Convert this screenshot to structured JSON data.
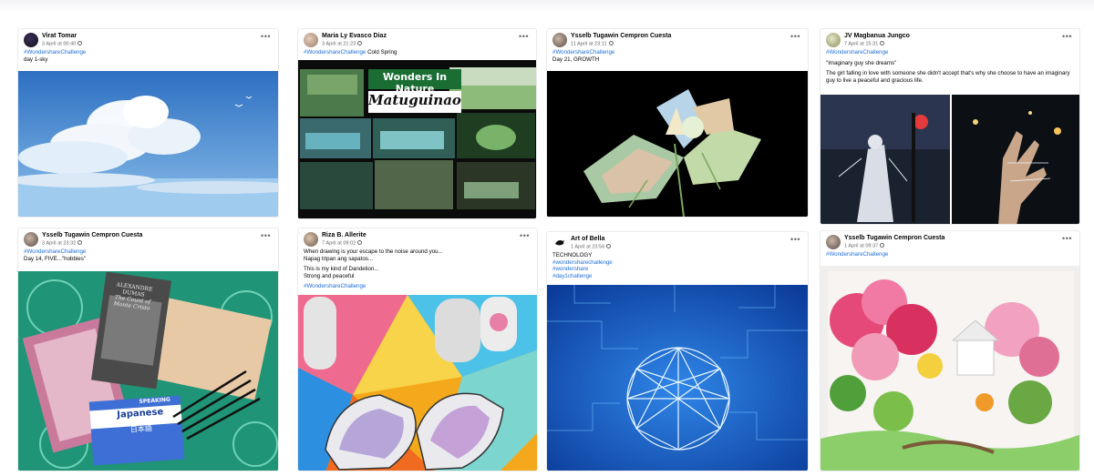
{
  "posts": [
    {
      "author": "Virat Tomar",
      "time": "3 April at 00:40",
      "lines": [
        {
          "text": "#WondershareChallenge",
          "tag": true
        },
        {
          "text": "day 1-sky",
          "tag": false
        }
      ],
      "media": "sky-clouds"
    },
    {
      "author": "Maria Ly Evasco Diaz",
      "time": "3 April at 21:23",
      "lines": [
        {
          "text": "#WondershareChallenge",
          "tag": true
        },
        {
          "text": " Cold Spring",
          "tag": false
        }
      ],
      "media": "wonders-in-nature",
      "media_title": "Wonders In Nature",
      "media_subtitle": "Matuguinao"
    },
    {
      "author": "Ysselb Tugawin Cempron Cuesta",
      "time": "11 April at 23:11",
      "lines": [
        {
          "text": "#WondershareChallenge",
          "tag": true
        },
        {
          "text": "Day 21, GROWTH",
          "tag": false
        }
      ],
      "media": "growth-collage"
    },
    {
      "author": "JV Magbanua Jungco",
      "time": "7 April at 15:31",
      "lines": [
        {
          "text": "#WondershareChallenge",
          "tag": true
        },
        {
          "text": "\"Imaginary guy she dreams\"",
          "tag": false
        },
        {
          "text": "The girl falling in love with someone she didn't accept that's why she choose to have an imaginary guy to live a peaceful and gracious life.",
          "tag": false
        }
      ],
      "media": "night-sketch"
    },
    {
      "author": "Ysselb Tugawin Cempron Cuesta",
      "time": "3 April at 23:32",
      "lines": [
        {
          "text": "#WondershareChallenge",
          "tag": true
        },
        {
          "text": "Day 14, FIVE...\"hobbies\"",
          "tag": false
        }
      ],
      "media": "hobbies-books",
      "book_text": [
        "ALEXANDRE",
        "DUMAS",
        "The Count of",
        "Monte Cristo"
      ],
      "book2_text": [
        "SPEAKING",
        "Japanese",
        "日本語"
      ]
    },
    {
      "author": "Riza B. Allerite",
      "time": "7 April at 09:02",
      "lines": [
        {
          "text": "When drawing is your escape to the noise around you...",
          "tag": false
        },
        {
          "text": "Napag tripan ang sapatos...",
          "tag": false
        },
        {
          "text": "This is my kind of Dandelion...",
          "tag": false
        },
        {
          "text": "Strong and peaceful",
          "tag": false
        },
        {
          "text": "#WondershareChallenge",
          "tag": true
        }
      ],
      "media": "painted-shoes"
    },
    {
      "author": "Art of Bella",
      "time": "1 April at 23:56",
      "lines": [
        {
          "text": "TECHNOLOGY",
          "tag": false
        },
        {
          "text": "#wondersharechallenge",
          "tag": true
        },
        {
          "text": "#wondershare",
          "tag": true
        },
        {
          "text": "#day1challenge",
          "tag": true
        }
      ],
      "media": "technology-network"
    },
    {
      "author": "Ysselb Tugawin Cempron Cuesta",
      "time": "1 April at 09:37",
      "lines": [
        {
          "text": "#WondershareChallenge",
          "tag": true
        }
      ],
      "media": "garden-painting"
    }
  ],
  "more_label": "•••",
  "colors": {
    "hashtag": "#216fdb",
    "meta": "#65676b"
  }
}
